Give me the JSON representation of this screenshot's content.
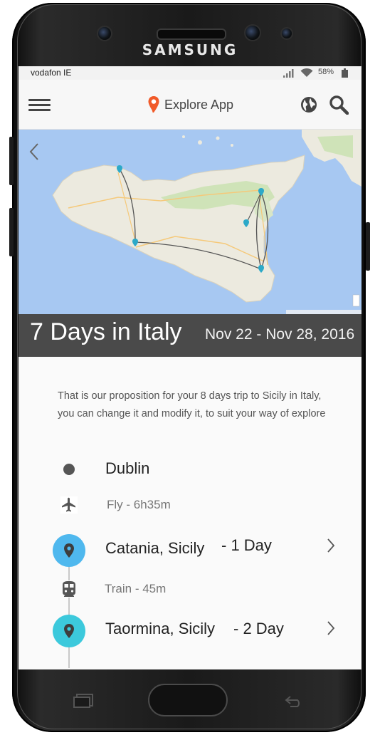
{
  "device": {
    "brand": "SAMSUNG"
  },
  "status_bar": {
    "carrier": "vodafon IE",
    "battery": "58%"
  },
  "app_bar": {
    "title": "Explore App",
    "menu_icon": "hamburger-menu-icon",
    "globe_icon": "globe-icon",
    "search_icon": "search-icon"
  },
  "trip": {
    "title": "7 Days in Italy",
    "dates": "Nov 22 - Nov 28, 2016",
    "intro_line1": "That is our proposition for your 8 days trip to Sicily in Italy,",
    "intro_line2": "you can change it and modify it, to suit your way of explore"
  },
  "itinerary": {
    "start": {
      "city": "Dublin"
    },
    "leg1": {
      "mode_icon": "airplane-icon",
      "label": "Fly - 6h35m"
    },
    "stop1": {
      "city": "Catania, Sicily",
      "duration": "- 1 Day",
      "color": "#4fb8ee"
    },
    "leg2": {
      "mode_icon": "train-icon",
      "label": "Train - 45m"
    },
    "stop2": {
      "city": "Taormina, Sicily",
      "duration": "- 2 Day",
      "color": "#3cc9dc"
    }
  },
  "colors": {
    "accent": "#f15a29",
    "banner": "#4a4a4a",
    "map_sea": "#a7c8f2",
    "map_land": "#eceadf"
  }
}
